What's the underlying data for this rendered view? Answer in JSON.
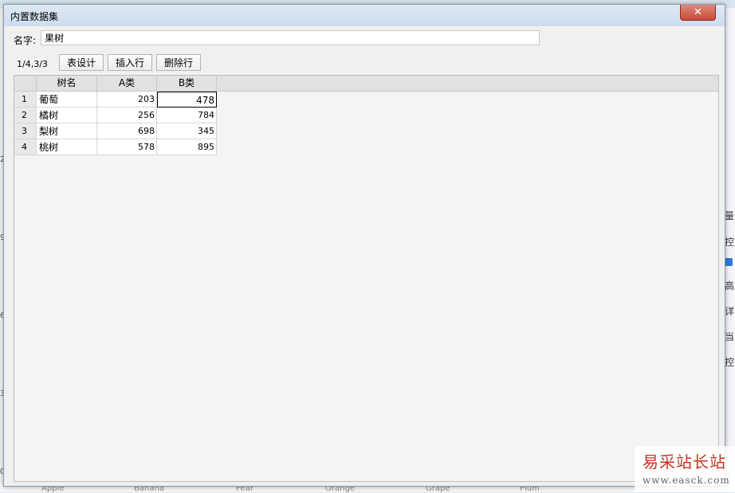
{
  "dialog": {
    "title": "内置数据集",
    "close_label": "✕"
  },
  "name_field": {
    "label": "名字:",
    "value": "果树"
  },
  "toolbar": {
    "counter": "1/4,3/3",
    "table_design_label": "表设计",
    "insert_row_label": "插入行",
    "delete_row_label": "删除行"
  },
  "table": {
    "columns": [
      "",
      "树名",
      "A类",
      "B类"
    ],
    "rows": [
      {
        "num": "1",
        "name": "葡萄",
        "a": "203",
        "b": "478"
      },
      {
        "num": "2",
        "name": "橘树",
        "a": "256",
        "b": "784"
      },
      {
        "num": "3",
        "name": "梨树",
        "a": "698",
        "b": "345"
      },
      {
        "num": "4",
        "name": "桃树",
        "a": "578",
        "b": "895"
      }
    ]
  },
  "background": {
    "left_ticks": [
      "2",
      "9",
      "6",
      "3",
      "0"
    ],
    "right_glyphs": [
      "量",
      "控",
      "高",
      "详",
      "当",
      "控"
    ],
    "bottom_labels": [
      "Apple",
      "Banana",
      "Pear",
      "Orange",
      "Grape",
      "Plum"
    ]
  },
  "watermark": {
    "brand": "易采站长站",
    "url": "www.easck.com"
  }
}
